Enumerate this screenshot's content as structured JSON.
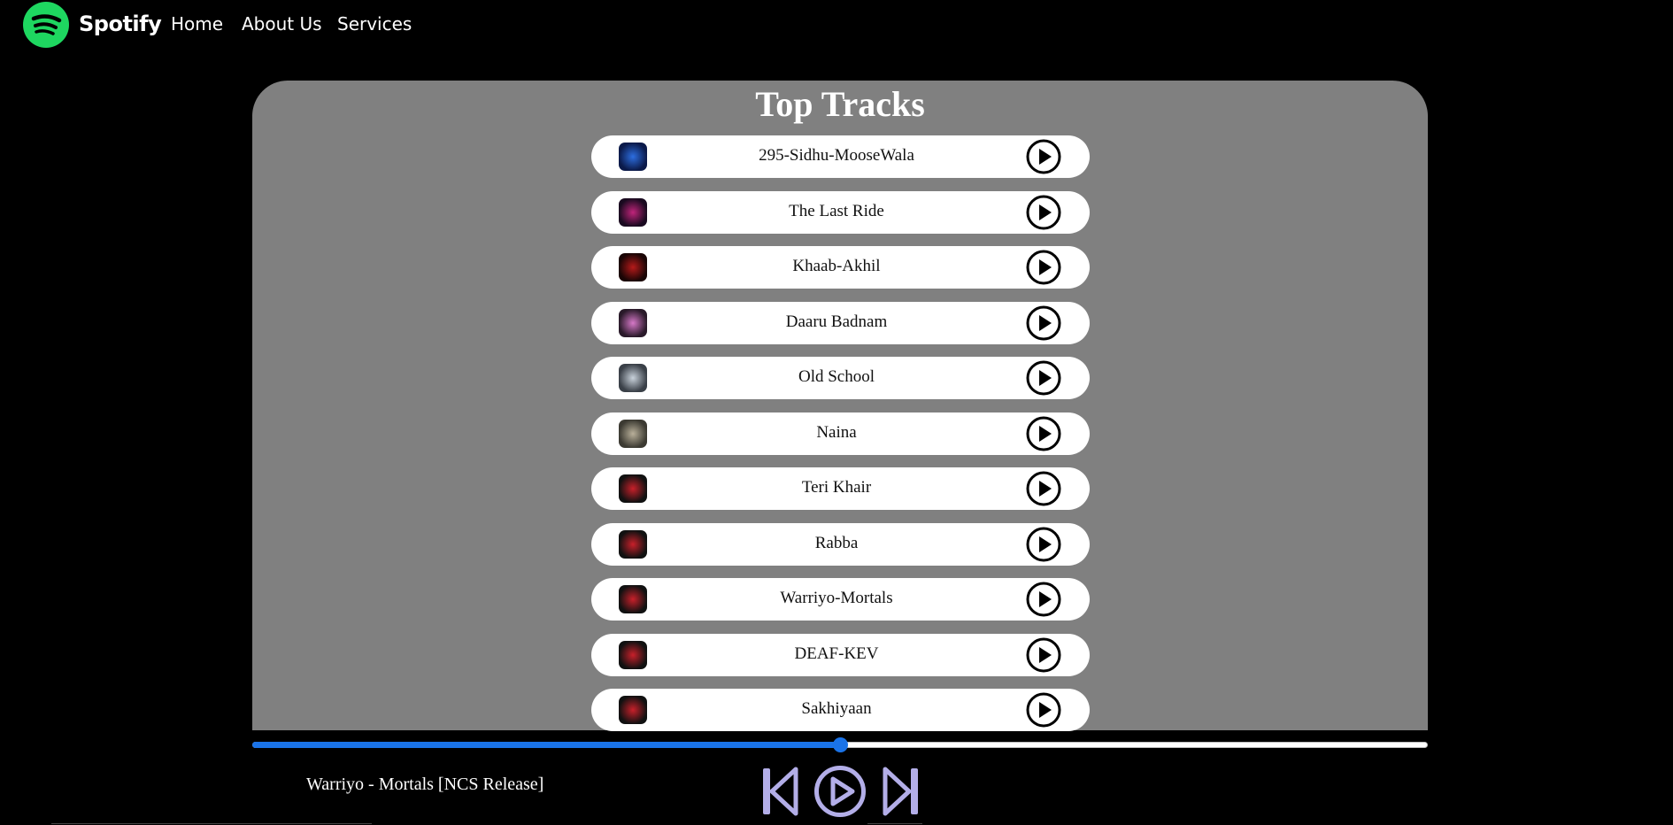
{
  "nav": {
    "brand": "Spotify",
    "links": [
      "Home",
      "About Us",
      "Services"
    ],
    "logo_color": "#1ed760"
  },
  "main": {
    "title": "Top Tracks",
    "tracks": [
      {
        "name": "295-Sidhu-MooseWala",
        "thumb_colors": [
          "#0b1a4a",
          "#2d6ee0"
        ]
      },
      {
        "name": "The Last Ride",
        "thumb_colors": [
          "#1a0a20",
          "#c0247a"
        ]
      },
      {
        "name": "Khaab-Akhil",
        "thumb_colors": [
          "#1a0505",
          "#b51a1a"
        ]
      },
      {
        "name": "Daaru Badnam",
        "thumb_colors": [
          "#2a1a2a",
          "#d678c8"
        ]
      },
      {
        "name": "Old School",
        "thumb_colors": [
          "#3a4048",
          "#c9d2db"
        ]
      },
      {
        "name": "Naina",
        "thumb_colors": [
          "#3c3a32",
          "#b9b09a"
        ]
      },
      {
        "name": "Teri Khair",
        "thumb_colors": [
          "#111",
          "#c8202a"
        ]
      },
      {
        "name": "Rabba",
        "thumb_colors": [
          "#111",
          "#c8202a"
        ]
      },
      {
        "name": "Warriyo-Mortals",
        "thumb_colors": [
          "#111",
          "#c8202a"
        ]
      },
      {
        "name": "DEAF-KEV",
        "thumb_colors": [
          "#111",
          "#c8202a"
        ]
      },
      {
        "name": "Sakhiyaan",
        "thumb_colors": [
          "#111",
          "#c8202a"
        ]
      }
    ]
  },
  "player": {
    "now_playing": "Warriyo - Mortals [NCS Release]",
    "progress": 0.5,
    "accent": "#1a73e8",
    "control_color": "#b3aee8"
  }
}
